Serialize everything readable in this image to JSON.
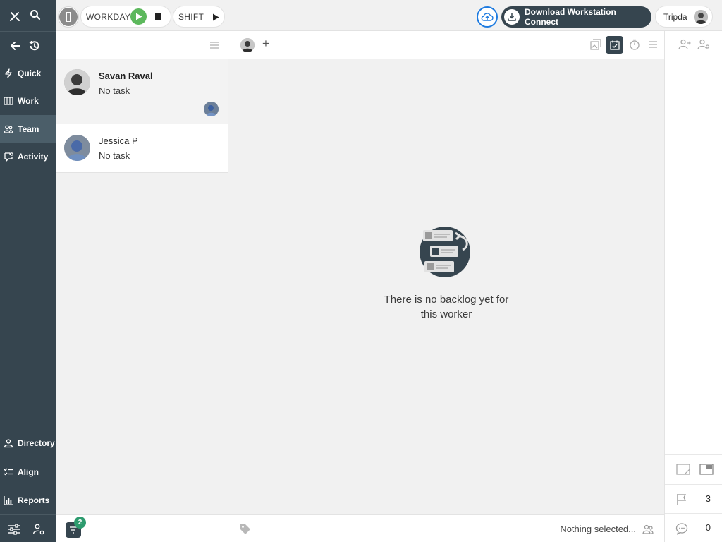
{
  "nav": {
    "items": [
      {
        "label": "Quick"
      },
      {
        "label": "Work"
      },
      {
        "label": "Team"
      },
      {
        "label": "Activity"
      },
      {
        "label": "Directory"
      },
      {
        "label": "Align"
      },
      {
        "label": "Reports"
      }
    ],
    "active": "Team"
  },
  "topbar": {
    "workday_label": "WORKDAY",
    "shift_label": "SHIFT",
    "download_label": "Download Workstation Connect",
    "user_name": "Tripda"
  },
  "workers": [
    {
      "name": "Savan Raval",
      "task": "No task"
    },
    {
      "name": "Jessica P",
      "task": "No task"
    }
  ],
  "list_footer": {
    "badge_count": "2"
  },
  "main": {
    "empty_message_line1": "There is no backlog yet for",
    "empty_message_line2": "this worker",
    "add_symbol": "+",
    "footer_status": "Nothing selected..."
  },
  "right_panel": {
    "flag_count": "3",
    "comment_count": "0"
  },
  "colors": {
    "sidebar": "#36454f",
    "sidebar_active": "#4b5e69",
    "play_green": "#5cb85c",
    "badge_green": "#2d9b6e",
    "cloud_ring": "#1e7be0"
  }
}
